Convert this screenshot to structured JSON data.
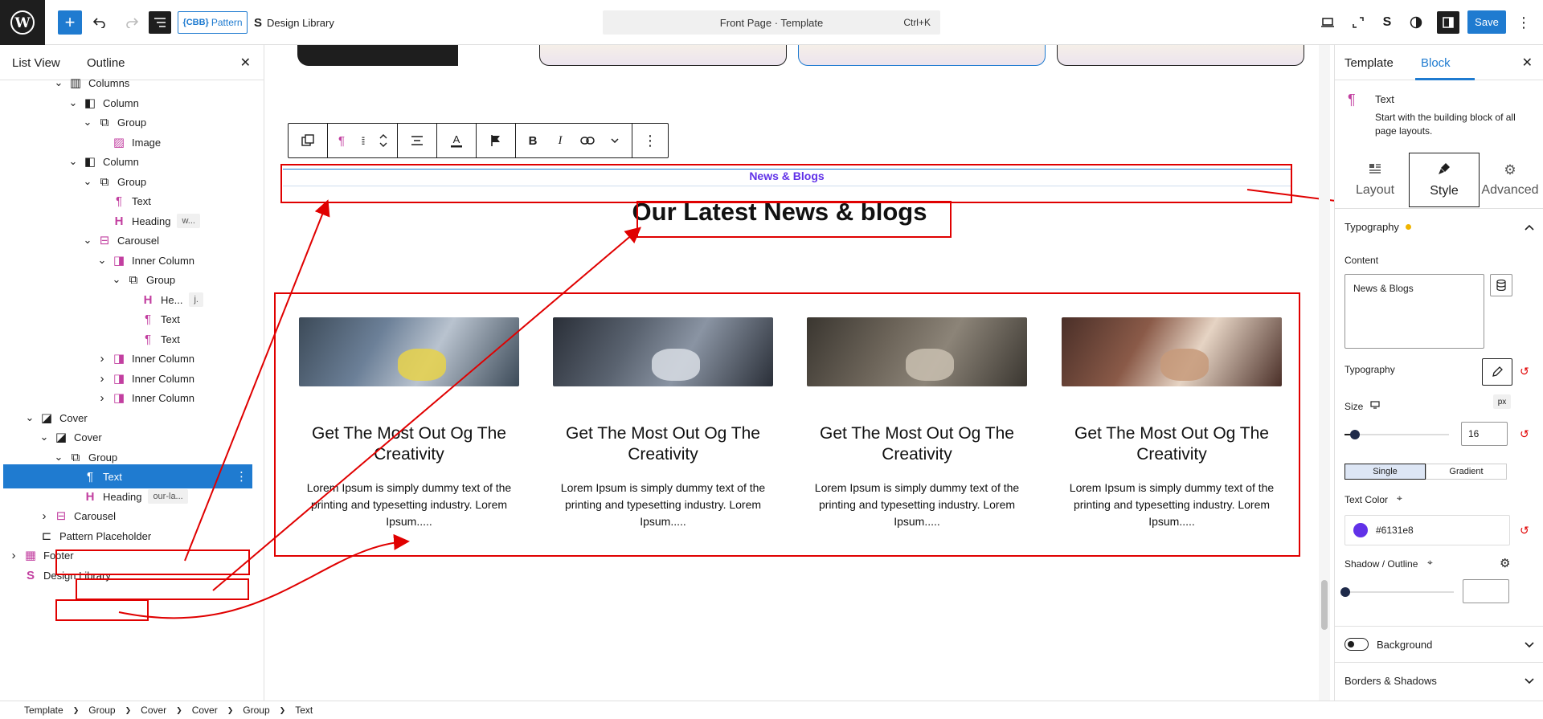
{
  "topbar": {
    "pattern_label": "Pattern",
    "pattern_badge": "{CBB}",
    "design_library_label": "Design Library",
    "document_title": "Front Page · Template",
    "shortcut": "Ctrl+K",
    "save_label": "Save",
    "accent": "#1f7bd0"
  },
  "left_panel": {
    "tab_list_view": "List View",
    "tab_outline": "Outline",
    "tree": [
      {
        "label": "Columns",
        "icon": "columns-icon"
      },
      {
        "label": "Column",
        "icon": "column-icon"
      },
      {
        "label": "Group",
        "icon": "group-icon"
      },
      {
        "label": "Image",
        "icon": "image-icon"
      },
      {
        "label": "Column",
        "icon": "column-icon"
      },
      {
        "label": "Group",
        "icon": "group-icon"
      },
      {
        "label": "Text",
        "icon": "paragraph-icon"
      },
      {
        "label": "Heading",
        "icon": "heading-icon",
        "tag": "w..."
      },
      {
        "label": "Carousel",
        "icon": "carousel-icon"
      },
      {
        "label": "Inner Column",
        "icon": "inner-column-icon"
      },
      {
        "label": "Group",
        "icon": "group-icon"
      },
      {
        "label": "He...",
        "icon": "heading-icon",
        "tag": "j."
      },
      {
        "label": "Text",
        "icon": "paragraph-icon"
      },
      {
        "label": "Text",
        "icon": "paragraph-icon"
      },
      {
        "label": "Inner Column",
        "icon": "inner-column-icon"
      },
      {
        "label": "Inner Column",
        "icon": "inner-column-icon"
      },
      {
        "label": "Inner Column",
        "icon": "inner-column-icon"
      },
      {
        "label": "Cover",
        "icon": "cover-icon"
      },
      {
        "label": "Cover",
        "icon": "cover-icon"
      },
      {
        "label": "Group",
        "icon": "group-icon"
      },
      {
        "label": "Text",
        "icon": "paragraph-icon",
        "selected": true
      },
      {
        "label": "Heading",
        "icon": "heading-icon",
        "tag": "our-la..."
      },
      {
        "label": "Carousel",
        "icon": "carousel-icon"
      },
      {
        "label": "Pattern Placeholder",
        "icon": "pattern-placeholder-icon"
      },
      {
        "label": "Footer",
        "icon": "footer-icon"
      },
      {
        "label": "Design Library",
        "icon": "design-library-icon"
      }
    ]
  },
  "canvas": {
    "section_label": "News & Blogs",
    "section_heading": "Our Latest News & blogs",
    "posts": [
      {
        "title": "Get The Most Out Og The Creativity",
        "text": "Lorem Ipsum is simply dummy text of the printing and typesetting industry. Lorem Ipsum....."
      },
      {
        "title": "Get The Most Out Og The Creativity",
        "text": "Lorem Ipsum is simply dummy text of the printing and typesetting industry. Lorem Ipsum....."
      },
      {
        "title": "Get The Most Out Og The Creativity",
        "text": "Lorem Ipsum is simply dummy text of the printing and typesetting industry. Lorem Ipsum....."
      },
      {
        "title": "Get The Most Out Og The Creativity",
        "text": "Lorem Ipsum is simply dummy text of the printing and typesetting industry. Lorem Ipsum....."
      }
    ],
    "annotation_color": "#e00000"
  },
  "right_panel": {
    "tab_template": "Template",
    "tab_block": "Block",
    "block_name": "Text",
    "block_description": "Start with the building block of all page layouts.",
    "subtab_layout": "Layout",
    "subtab_style": "Style",
    "subtab_advanced": "Advanced",
    "typography_section": "Typography",
    "content_label": "Content",
    "content_value": "News & Blogs",
    "typography_label": "Typography",
    "size_label": "Size",
    "size_unit": "px",
    "size_value": "16",
    "size_fraction": 0.1,
    "seg_single": "Single",
    "seg_gradient": "Gradient",
    "text_color_label": "Text Color",
    "text_color_value": "#6131e8",
    "shadow_label": "Shadow / Outline",
    "shadow_value": "",
    "background_label": "Background",
    "borders_label": "Borders & Shadows"
  },
  "breadcrumb": [
    "Template",
    "Group",
    "Cover",
    "Cover",
    "Group",
    "Text"
  ]
}
